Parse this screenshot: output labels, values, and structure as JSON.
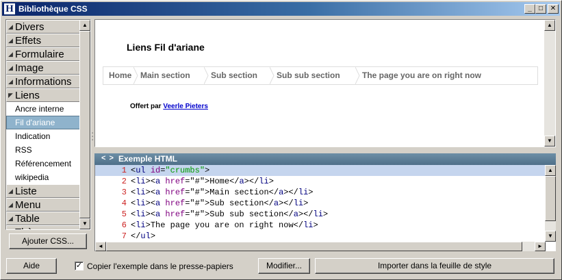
{
  "window": {
    "title": "Bibliothèque CSS",
    "icon_letter": "H",
    "buttons": [
      "_",
      "□",
      "✕"
    ]
  },
  "sidebar": {
    "categories_before": [
      {
        "label": "Divers"
      },
      {
        "label": "Effets"
      },
      {
        "label": "Formulaire"
      },
      {
        "label": "Image"
      },
      {
        "label": "Informations"
      }
    ],
    "open_category": {
      "label": "Liens"
    },
    "subitems": [
      {
        "label": "Ancre interne",
        "selected": false
      },
      {
        "label": "Fil d'ariane",
        "selected": true
      },
      {
        "label": "Indication",
        "selected": false
      },
      {
        "label": "RSS",
        "selected": false
      },
      {
        "label": "Référencement",
        "selected": false
      },
      {
        "label": "wikipedia",
        "selected": false
      }
    ],
    "categories_after": [
      {
        "label": "Liste"
      },
      {
        "label": "Menu"
      },
      {
        "label": "Table"
      },
      {
        "label": "Thème"
      }
    ],
    "add_css_label": "Ajouter CSS..."
  },
  "preview": {
    "title": "Liens Fil d'ariane",
    "crumbs": [
      "Home",
      "Main section",
      "Sub section",
      "Sub sub section",
      "The page you are on right now"
    ],
    "credit_prefix": "Offert par",
    "credit_link": "Veerle Pieters"
  },
  "code": {
    "header_icon": "< >",
    "header_title": "Exemple HTML",
    "current_line": 1,
    "lines": [
      {
        "num": "1",
        "text": "<ul id=\"crumbs\">"
      },
      {
        "num": "2",
        "text": "<li><a href=\"#\">Home</a></li>"
      },
      {
        "num": "3",
        "text": "<li><a href=\"#\">Main section</a></li>"
      },
      {
        "num": "4",
        "text": "<li><a href=\"#\">Sub section</a></li>"
      },
      {
        "num": "5",
        "text": "<li><a href=\"#\">Sub sub section</a></li>"
      },
      {
        "num": "6",
        "text": "<li>The page you are on right now</li>"
      },
      {
        "num": "7",
        "text": "</ul>"
      }
    ]
  },
  "footer": {
    "help_label": "Aide",
    "copy_checked": true,
    "copy_label": "Copier l'exemple dans le presse-papiers",
    "modify_label": "Modifier...",
    "import_label": "Importer dans la feuille de style"
  },
  "colors": {
    "titlebar_start": "#0a246a",
    "selected_item": "#8fb3cc",
    "code_header": "#5e7f97",
    "line_number": "#cc2222",
    "link": "#0000cc"
  }
}
